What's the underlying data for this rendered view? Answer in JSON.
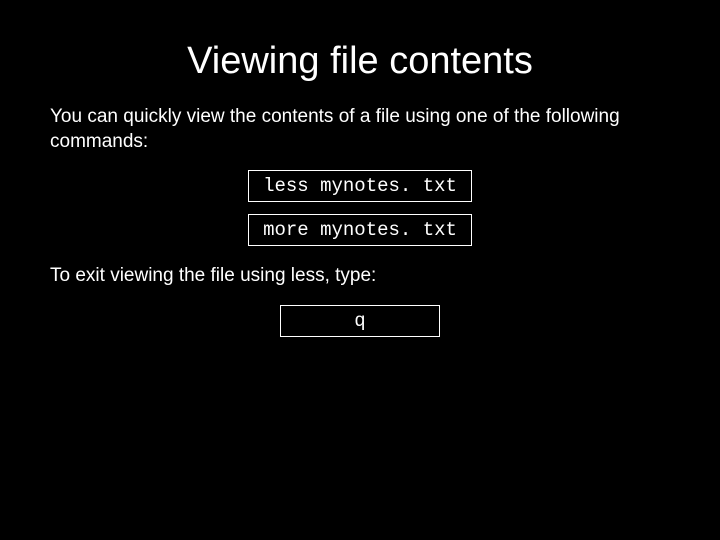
{
  "title": "Viewing file contents",
  "intro": "You can quickly view the contents of a file using one of the following commands:",
  "cmd1": "less mynotes. txt",
  "cmd2": "more mynotes. txt",
  "exit_text": "To exit viewing the file using less, type:",
  "cmd3": "q"
}
